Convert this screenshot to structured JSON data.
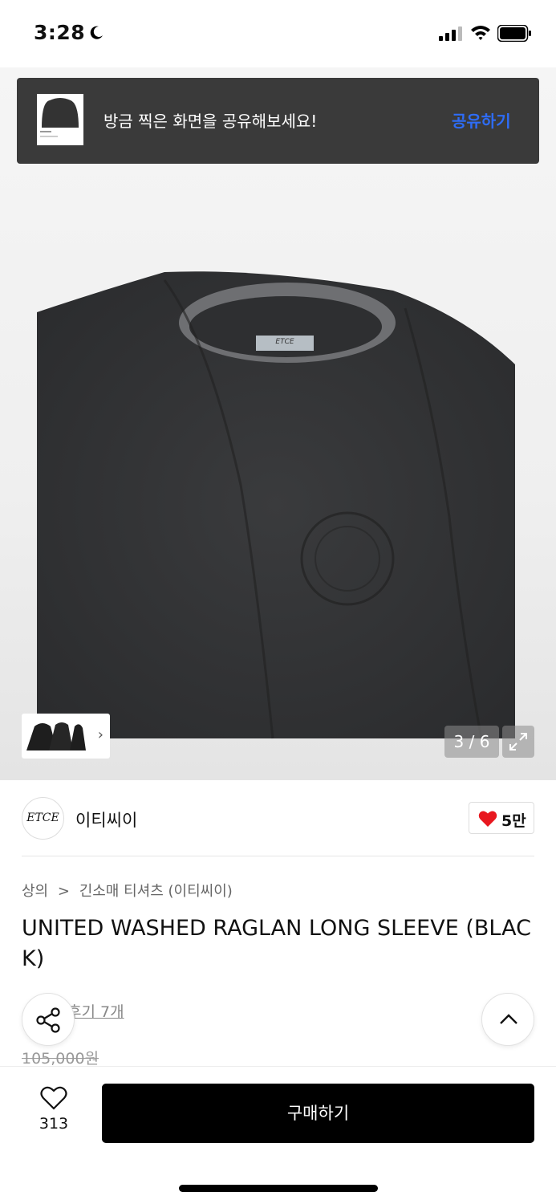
{
  "status_bar": {
    "time": "3:28"
  },
  "toast": {
    "message": "방금 찍은 화면을 공유해보세요!",
    "action_label": "공유하기"
  },
  "gallery": {
    "counter": "3 / 6",
    "tag_text": "ETCE"
  },
  "brand": {
    "logo_text": "ETCE",
    "name": "이티씨이",
    "likes": "5만"
  },
  "breadcrumb": {
    "category": "상의",
    "separator": ">",
    "subcategory": "긴소매 티셔츠 (이티씨이)"
  },
  "product": {
    "title": "UNITED WASHED RAGLAN LONG SLEEVE (BLACK)",
    "review_link": "후기 7개",
    "original_price": "105,000원"
  },
  "bottom_bar": {
    "wish_count": "313",
    "buy_label": "구매하기"
  },
  "colors": {
    "accent_blue": "#2e6cf6",
    "heart_red": "#e8171f",
    "toast_bg": "#3a3a3a",
    "buy_bg": "#000000"
  }
}
